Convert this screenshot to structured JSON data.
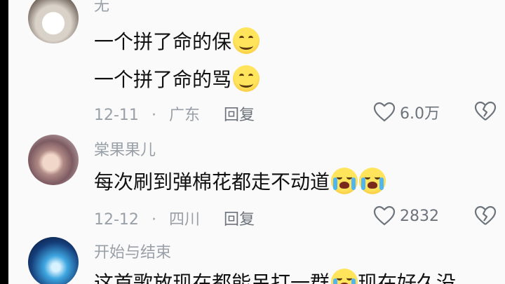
{
  "comments": [
    {
      "username": "无",
      "lines": [
        "一个拼了命的保",
        "一个拼了命的骂"
      ],
      "date": "12-11",
      "location": "广东",
      "reply": "回复",
      "likes": "6.0万"
    },
    {
      "username": "棠果果儿",
      "lines": [
        "每次刷到弹棉花都走不动道"
      ],
      "date": "12-12",
      "location": "四川",
      "reply": "回复",
      "likes": "2832"
    },
    {
      "username": "开始与结束",
      "lines": [
        "这首歌放现在都能吊打一群",
        "现在好久没"
      ]
    }
  ],
  "separator": "·",
  "colors": {
    "background": "#fafafa",
    "text": "#111111",
    "meta": "#9aa0a8"
  }
}
